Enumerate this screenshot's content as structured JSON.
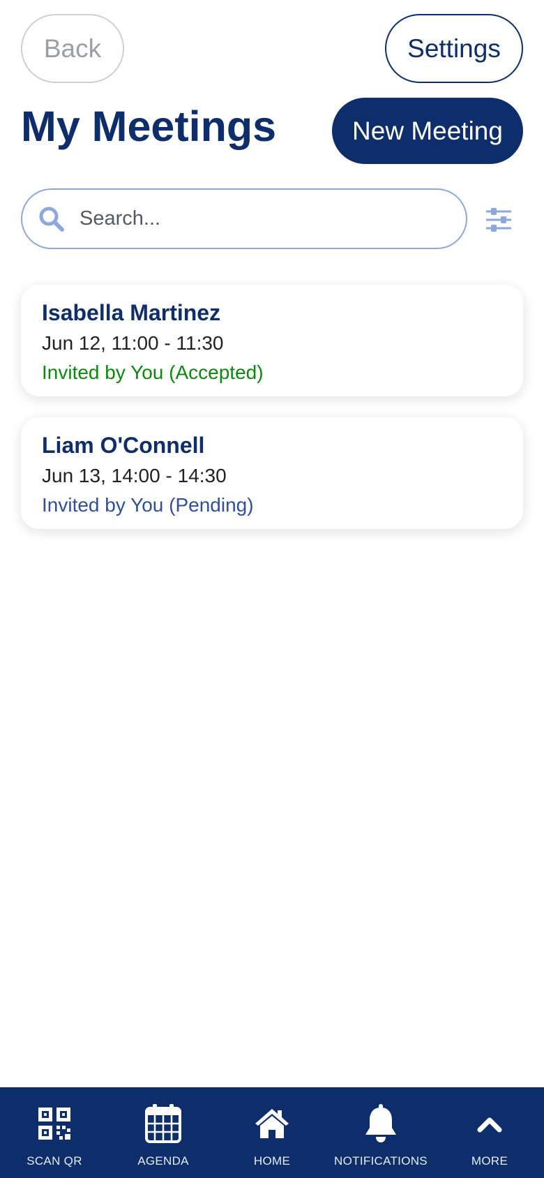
{
  "header": {
    "back_label": "Back",
    "settings_label": "Settings",
    "title": "My Meetings",
    "new_meeting_label": "New Meeting"
  },
  "search": {
    "placeholder": "Search...",
    "value": ""
  },
  "meetings": [
    {
      "name": "Isabella Martinez",
      "time": "Jun 12, 11:00 - 11:30",
      "status": "Invited by You (Accepted)",
      "status_color": "#0a8a0a"
    },
    {
      "name": "Liam O'Connell",
      "time": "Jun 13, 14:00 - 14:30",
      "status": "Invited by You (Pending)",
      "status_color": "#2f4f9a"
    }
  ],
  "nav": {
    "items": [
      {
        "label": "SCAN QR",
        "icon": "qr-code-icon"
      },
      {
        "label": "AGENDA",
        "icon": "calendar-icon"
      },
      {
        "label": "HOME",
        "icon": "home-icon"
      },
      {
        "label": "NOTIFICATIONS",
        "icon": "bell-icon"
      },
      {
        "label": "MORE",
        "icon": "chevron-up-icon"
      }
    ]
  },
  "colors": {
    "primary": "#0d2d6b",
    "search_border": "#8ea7dd",
    "accepted": "#0a8a0a",
    "pending": "#2f4f9a"
  }
}
